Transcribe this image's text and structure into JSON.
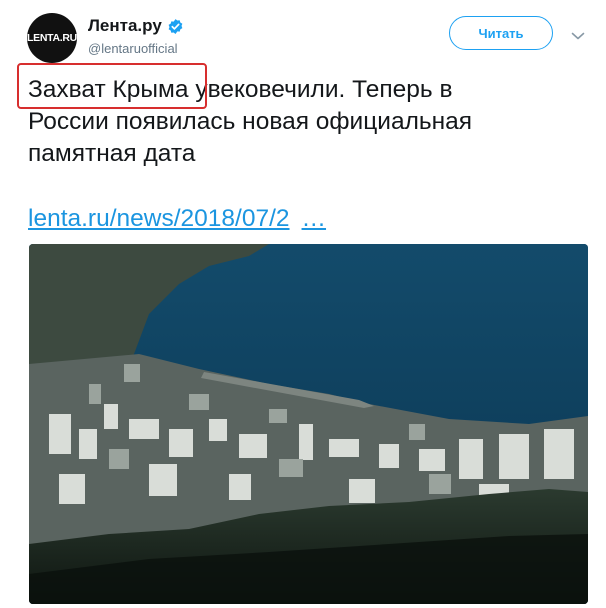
{
  "account": {
    "avatar_text": "LENTA.RU",
    "name": "Лента.ру",
    "handle": "@lentaruofficial"
  },
  "actions": {
    "follow_label": "Читать"
  },
  "tweet": {
    "highlighted_text": "Захват Крыма",
    "rest_line1": " увековечили. Теперь в",
    "line2": "России появилась новая официальная",
    "line3": "памятная дата",
    "link_url": "lenta.ru/news/2018/07/2",
    "link_ellipsis": "…"
  },
  "colors": {
    "link": "#1b95e0",
    "accent": "#1da1f2",
    "highlight_border": "#d72e2e",
    "sea": "#0b3b58"
  },
  "icons": {
    "verified": "verified-badge-icon",
    "caret": "chevron-down-icon"
  }
}
